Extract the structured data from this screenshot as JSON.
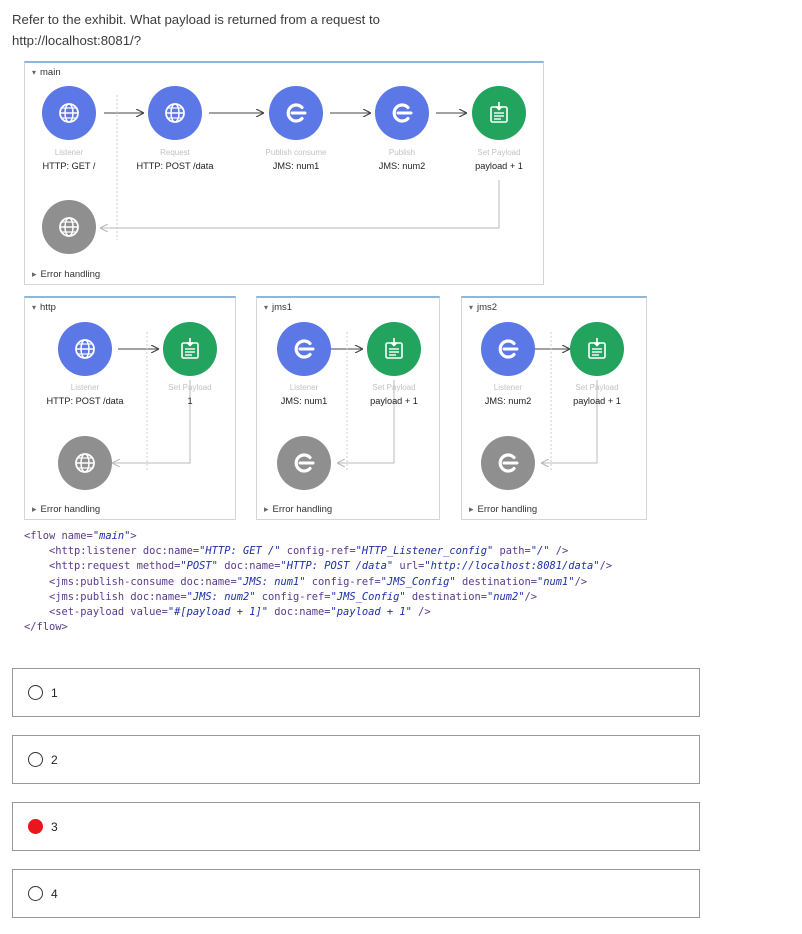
{
  "question": {
    "line1": "Refer to the exhibit. What payload is returned from a request to",
    "line2": "http://localhost:8081/?"
  },
  "exhibit": {
    "main_flow": {
      "title": "main",
      "nodes": [
        {
          "type": "Listener",
          "name": "HTTP: GET /",
          "icon": "globe-icon",
          "color": "#5b78e6"
        },
        {
          "type": "Request",
          "name": "HTTP: POST /data",
          "icon": "globe-icon",
          "color": "#5b78e6"
        },
        {
          "type": "Publish consume",
          "name": "JMS: num1",
          "icon": "jms-icon",
          "color": "#5b78e6"
        },
        {
          "type": "Publish",
          "name": "JMS: num2",
          "icon": "jms-icon",
          "color": "#5b78e6"
        },
        {
          "type": "Set Payload",
          "name": "payload + 1",
          "icon": "set-payload-icon",
          "color": "#22a35e"
        }
      ],
      "error_handling": "Error handling"
    },
    "http_flow": {
      "title": "http",
      "nodes": [
        {
          "type": "Listener",
          "name": "HTTP: POST /data"
        },
        {
          "type": "Set Payload",
          "name": "1"
        }
      ],
      "error_handling": "Error handling"
    },
    "jms1_flow": {
      "title": "jms1",
      "nodes": [
        {
          "type": "Listener",
          "name": "JMS: num1"
        },
        {
          "type": "Set Payload",
          "name": "payload + 1"
        }
      ],
      "error_handling": "Error handling"
    },
    "jms2_flow": {
      "title": "jms2",
      "nodes": [
        {
          "type": "Listener",
          "name": "JMS: num2"
        },
        {
          "type": "Set Payload",
          "name": "payload + 1"
        }
      ],
      "error_handling": "Error handling"
    },
    "code": {
      "l1a": "<flow name=",
      "l1b": "\"main\"",
      "l1c": ">",
      "l2a": "    <http:listener doc:name=",
      "l2b": "\"HTTP: GET /\"",
      "l2c": " config-ref=",
      "l2d": "\"HTTP_Listener_config\"",
      "l2e": " path=",
      "l2f": "\"/\"",
      "l2g": " />",
      "l3a": "    <http:request method=",
      "l3b": "\"POST\"",
      "l3c": " doc:name=",
      "l3d": "\"HTTP: POST /data\"",
      "l3e": " url=",
      "l3f": "\"http://localhost:8081/data\"",
      "l3g": "/>",
      "l4a": "    <jms:publish-consume doc:name=",
      "l4b": "\"JMS: num1\"",
      "l4c": " config-ref=",
      "l4d": "\"JMS_Config\"",
      "l4e": " destination=",
      "l4f": "\"num1\"",
      "l4g": "/>",
      "l5a": "    <jms:publish doc:name=",
      "l5b": "\"JMS: num2\"",
      "l5c": " config-ref=",
      "l5d": "\"JMS_Config\"",
      "l5e": " destination=",
      "l5f": "\"num2\"",
      "l5g": "/>",
      "l6a": "    <set-payload value=",
      "l6b": "\"#[payload + 1]\"",
      "l6c": " doc:name=",
      "l6d": "\"payload + 1\"",
      "l6e": " />",
      "l7a": "</flow>"
    }
  },
  "options": [
    {
      "label": "1",
      "selected": false
    },
    {
      "label": "2",
      "selected": false
    },
    {
      "label": "3",
      "selected": true
    },
    {
      "label": "4",
      "selected": false
    }
  ],
  "colors": {
    "selected_radio": "#e8171d",
    "panel_accent": "#8fb6d8"
  }
}
